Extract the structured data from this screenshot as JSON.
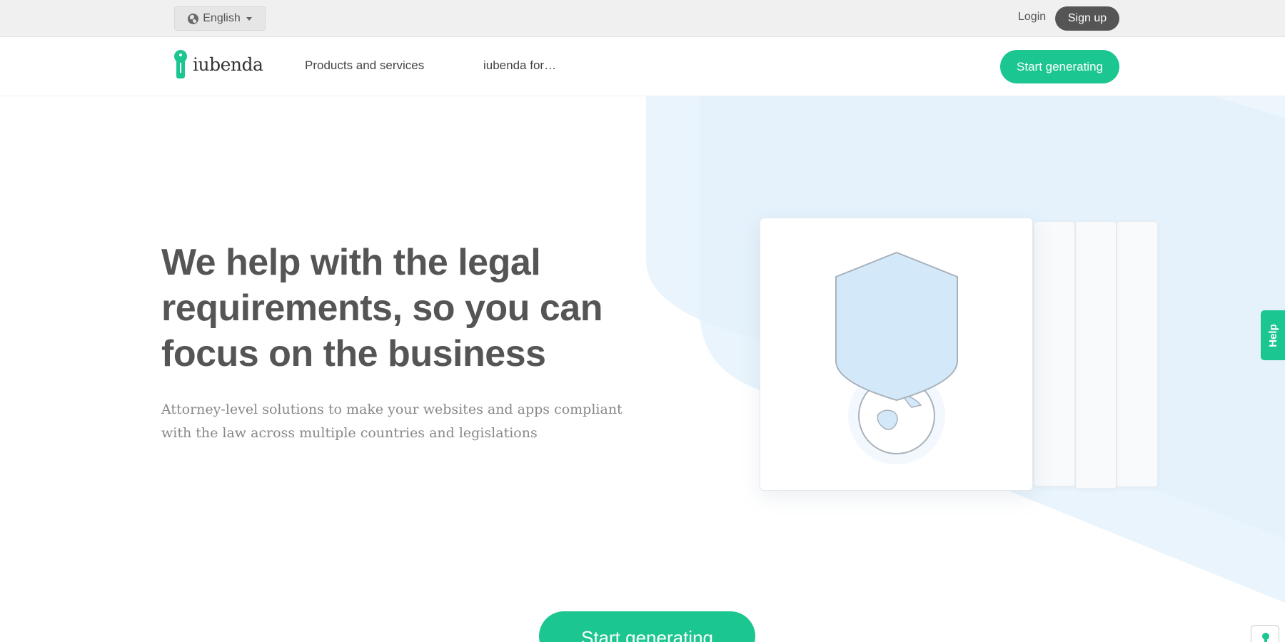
{
  "topbar": {
    "language_label": "English",
    "login_label": "Login",
    "signup_label": "Sign up"
  },
  "navbar": {
    "logo_text": "iubenda",
    "links": [
      {
        "label": "Products and services"
      },
      {
        "label": "iubenda for…"
      }
    ],
    "cta_label": "Start generating"
  },
  "hero": {
    "title": "We help with the legal requirements, so you can focus on the business",
    "subtitle": "Attorney-level solutions to make your websites and apps compliant with the law across multiple countries and legislations"
  },
  "help_tab": {
    "label": "Help"
  },
  "bottom_cta": {
    "label": "Start generating"
  },
  "colors": {
    "brand_green": "#1cc691",
    "dark_button": "#555555",
    "hero_bg_blue": "#e6f2fb",
    "shield_fill": "#d3e9fa"
  },
  "icons": [
    "globe-icon",
    "caret-down-icon",
    "iubenda-logo-icon",
    "shield-icon",
    "globe-illustration-icon"
  ]
}
